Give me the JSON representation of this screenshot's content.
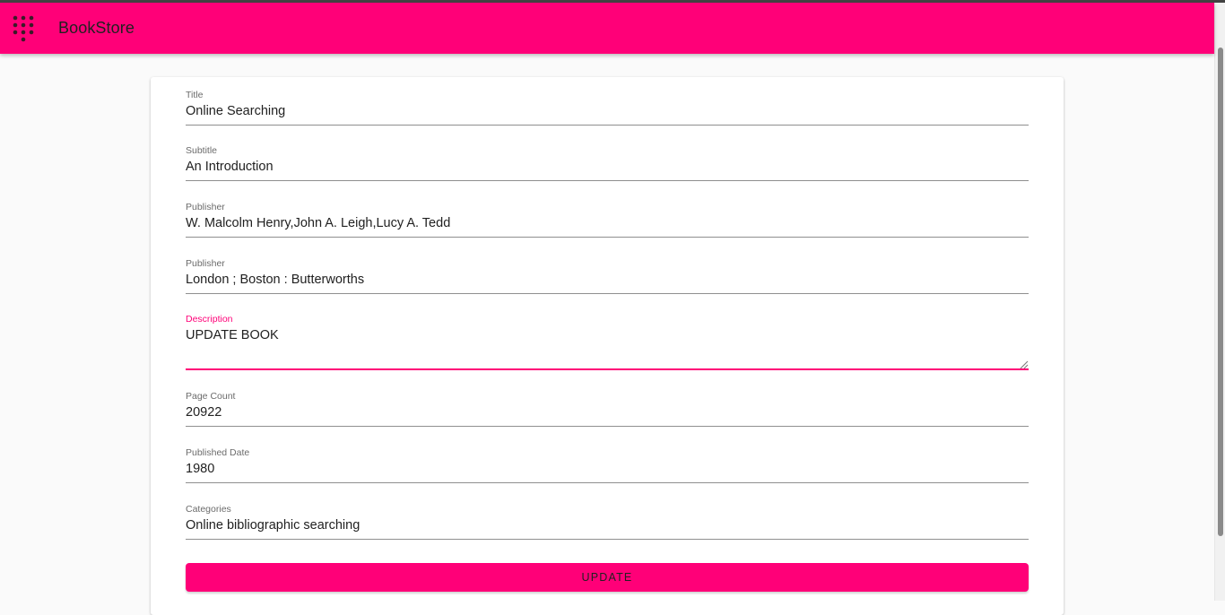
{
  "app": {
    "title": "BookStore",
    "menu_icon": "grid-menu-icon",
    "accent_color": "#ff0078"
  },
  "form": {
    "fields": [
      {
        "label": "Title",
        "value": "Online Searching"
      },
      {
        "label": "Subtitle",
        "value": "An Introduction"
      },
      {
        "label": "Publisher",
        "value": "W. Malcolm Henry,John A. Leigh,Lucy A. Tedd"
      },
      {
        "label": "Publisher",
        "value": "London ; Boston : Butterworths"
      },
      {
        "label": "Description",
        "value": "UPDATE BOOK",
        "focused": true
      },
      {
        "label": "Page Count",
        "value": "20922"
      },
      {
        "label": "Published Date",
        "value": "1980"
      },
      {
        "label": "Categories",
        "value": "Online bibliographic searching"
      }
    ],
    "submit_label": "UPDATE"
  }
}
